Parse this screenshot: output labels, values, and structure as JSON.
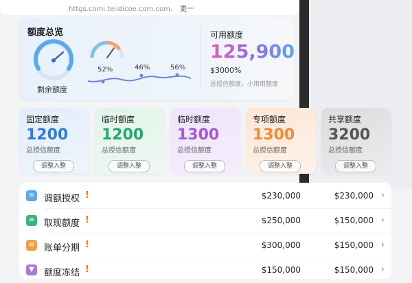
{
  "browser": {
    "url": "httgs.comı.teiıdicoe.com.com.",
    "more_label": "更一"
  },
  "overview": {
    "title": "额度总览",
    "gauge_label": "剩余额度",
    "percents": [
      "52%",
      "46%",
      "56%"
    ],
    "available_label": "可用额度",
    "available_value": "125,900",
    "available_pct": "$3000%",
    "available_note": "总授信额度，小用用额度"
  },
  "quotas": [
    {
      "title": "固定额度",
      "value": "1200",
      "note": "总授信额度",
      "button": "调整入整"
    },
    {
      "title": "临时额度",
      "value": "1200",
      "note": "总授信额度",
      "button": "调整入整"
    },
    {
      "title": "临时额度",
      "value": "1300",
      "note": "总授信额度",
      "button": "调整入整"
    },
    {
      "title": "专项额度",
      "value": "1300",
      "note": "总授信额度",
      "button": "调整入整"
    },
    {
      "title": "共享额度",
      "value": "3200",
      "note": "总授信额度",
      "button": "调整入整"
    }
  ],
  "list": [
    {
      "label": "调额授权",
      "icon": "document-icon",
      "warn": "!",
      "v1": "$230,000",
      "v2": "$230,000"
    },
    {
      "label": "取现额度",
      "icon": "cash-icon",
      "warn": "!",
      "v1": "$250,000",
      "v2": "$150,000"
    },
    {
      "label": "账单分期",
      "icon": "bill-icon",
      "warn": "!",
      "v1": "$300,000",
      "v2": "$150,000"
    },
    {
      "label": "额度冻结",
      "icon": "freeze-icon",
      "warn": "!",
      "v1": "$150,000",
      "v2": "$150,000"
    }
  ],
  "colors": {
    "accent_blue": "#2f7ae0",
    "accent_green": "#23a870",
    "accent_purple": "#a45ad6",
    "accent_orange": "#ef8a3a",
    "warn": "#e8742c"
  }
}
